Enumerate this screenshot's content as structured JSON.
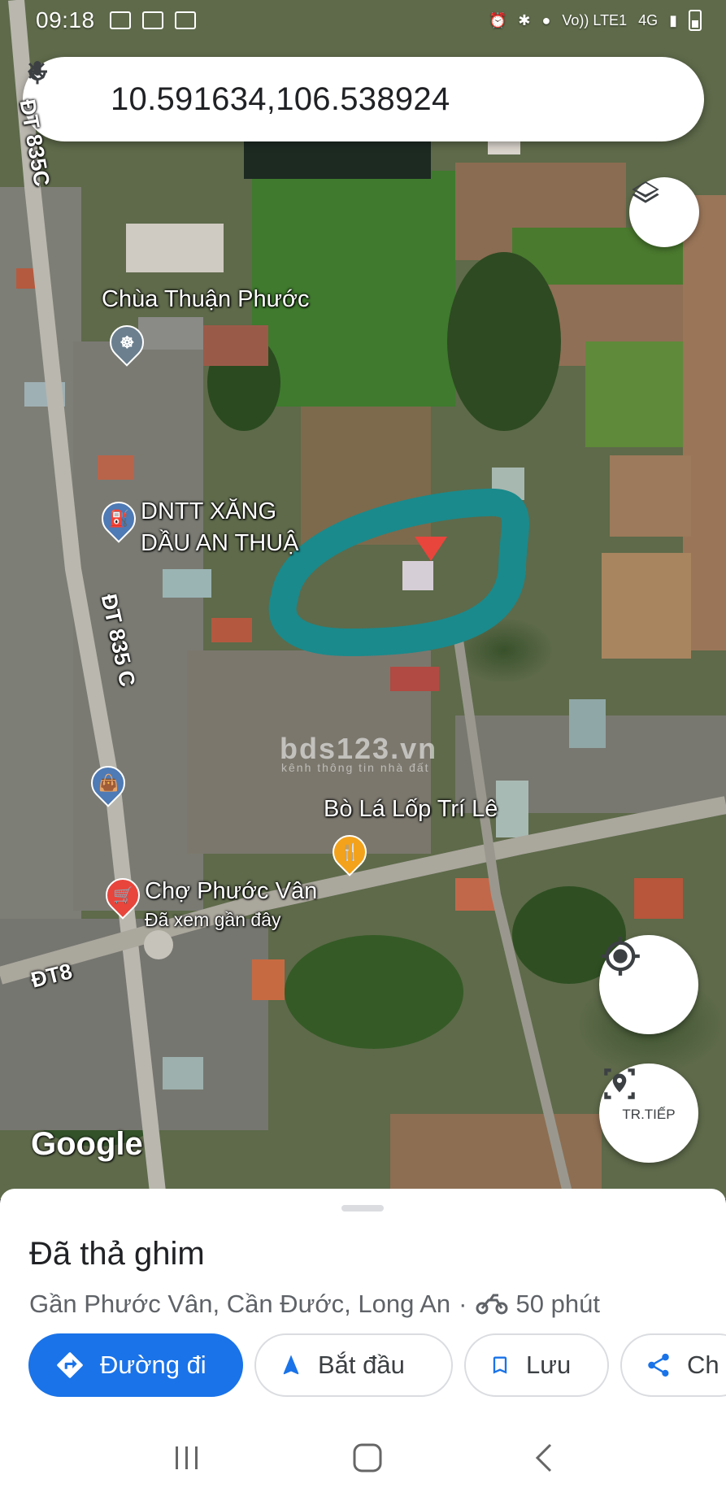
{
  "status_bar": {
    "time": "09:18",
    "network_text": "Vo)) LTE1",
    "network_type": "4G"
  },
  "search": {
    "query": "10.591634,106.538924"
  },
  "map": {
    "labels": {
      "road_835c_top": "ĐT 835C",
      "road_835c_mid": "ĐT 835 C",
      "road_dt8": "ĐT8",
      "temple": "Chùa Thuận Phước",
      "gas_line1": "DNTT XĂNG",
      "gas_line2": "DẦU AN THUẬ",
      "restaurant": "Bò Lá Lốp Trí Lê",
      "market": "Chợ Phước Vân",
      "market_sub": "Đã xem gần đây"
    },
    "watermark": "bds123.vn",
    "watermark_sub": "kênh thông tin nhà đất",
    "google_logo": "Google",
    "pin_color": "#e8453c",
    "highlight_color": "#1a8a8c"
  },
  "map_controls": {
    "explore_label": "TR.TIẾP"
  },
  "sheet": {
    "title": "Đã thả ghim",
    "subtitle": "Gần Phước Vân, Cần Đước, Long An",
    "separator": "·",
    "travel_time": "50 phút",
    "actions": {
      "directions": "Đường đi",
      "start": "Bắt đầu",
      "save": "Lưu",
      "share": "Ch"
    }
  },
  "colors": {
    "primary": "#1a73e8",
    "text_primary": "#202124",
    "text_secondary": "#5f6368"
  }
}
